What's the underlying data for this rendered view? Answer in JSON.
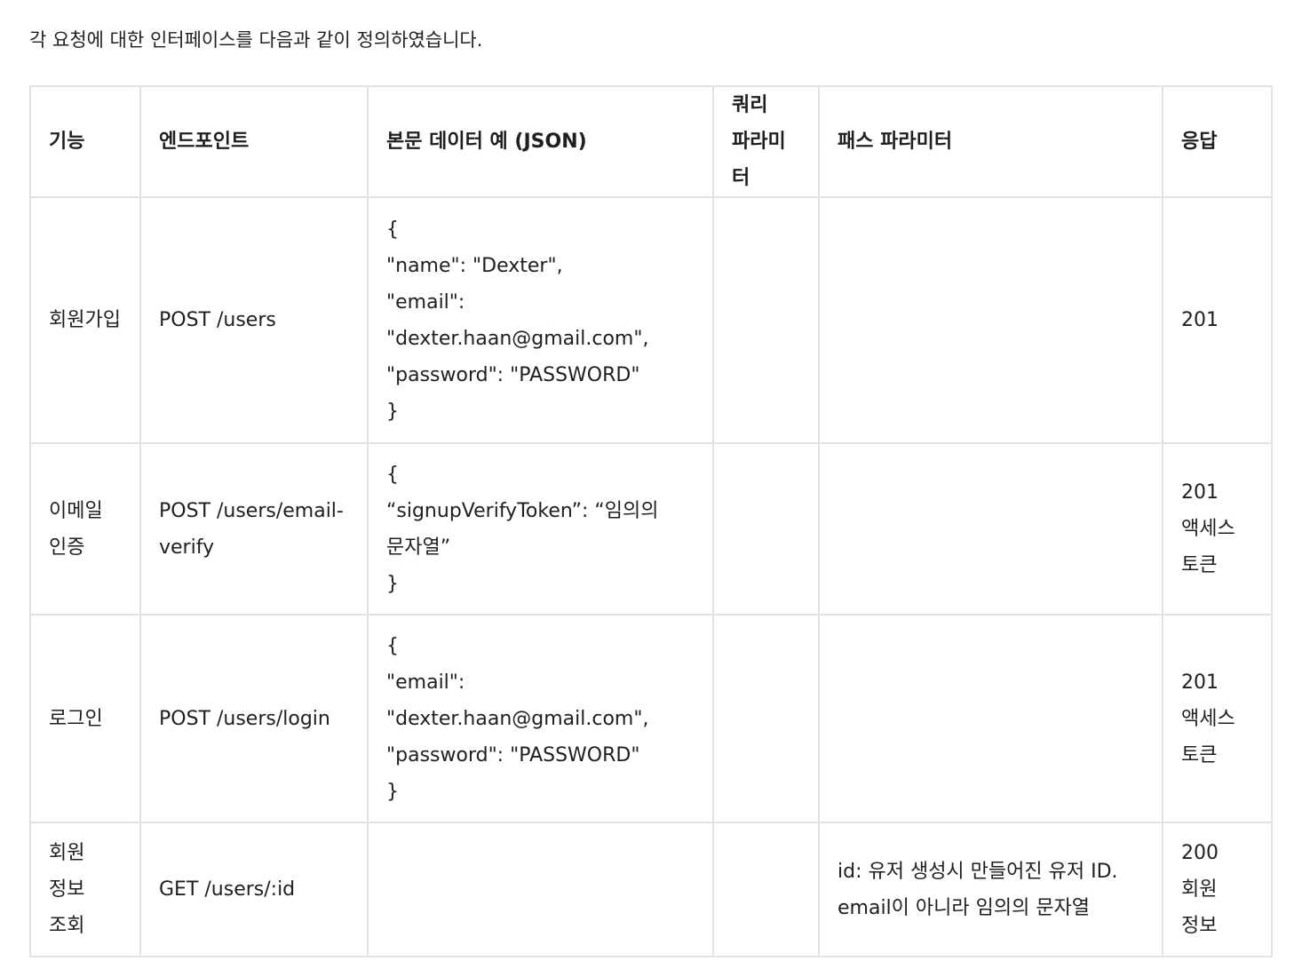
{
  "intro": "각 요청에 대한 인터페이스를 다음과 같이 정의하였습니다.",
  "table": {
    "headers": [
      "기능",
      "엔드포인트",
      "본문 데이터 예 (JSON)",
      "쿼리 파라미터",
      "패스 파라미터",
      "응답"
    ],
    "rows": [
      {
        "feature": "회원가입",
        "endpoint": "POST /users",
        "body": "{\n\"name\": \"Dexter\",\n\"email\": \"dexter.haan@gmail.com\",\n\"password\": \"PASSWORD\"\n}",
        "query": "",
        "path": "",
        "response": "201"
      },
      {
        "feature": "이메일 인증",
        "endpoint": "POST /users/email-verify",
        "body": "{\n“signupVerifyToken”: “임의의 문자열”\n}",
        "query": "",
        "path": "",
        "response": "201\n액세스 토큰"
      },
      {
        "feature": "로그인",
        "endpoint": "POST /users/login",
        "body": "{\n\"email\": \"dexter.haan@gmail.com\",\n\"password\": \"PASSWORD\"\n}",
        "query": "",
        "path": "",
        "response": "201\n액세스 토큰"
      },
      {
        "feature": "회원 정보 조회",
        "endpoint": "GET /users/:id",
        "body": "",
        "query": "",
        "path": "id: 유저 생성시 만들어진 유저 ID. email이 아니라 임의의 문자열",
        "response": "200\n회원 정보"
      }
    ]
  }
}
